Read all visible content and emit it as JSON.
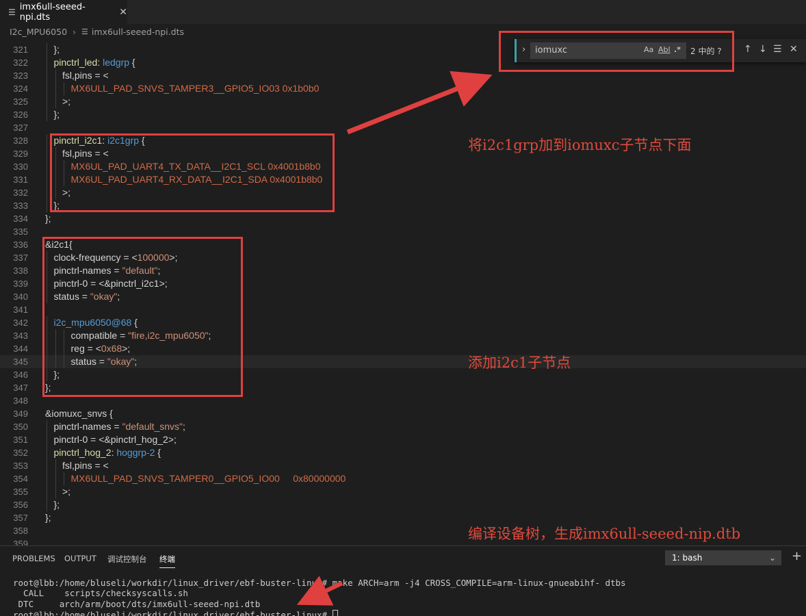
{
  "tab": {
    "title": "imx6ull-seeed-npi.dts",
    "close": "✕"
  },
  "breadcrumb": {
    "folder": "I2c_MPU6050",
    "file": "imx6ull-seeed-npi.dts"
  },
  "find": {
    "query": "iomuxc",
    "match_case": "Aa",
    "whole_word": "Abl",
    "regex": ".*",
    "count": "2 中的 ?"
  },
  "lines": [
    {
      "n": "321",
      "indent": 1,
      "parts": [
        [
          "plain",
          "};"
        ]
      ]
    },
    {
      "n": "322",
      "indent": 1,
      "parts": [
        [
          "label",
          "pinctrl_led"
        ],
        [
          "plain",
          ": "
        ],
        [
          "ref",
          "ledgrp"
        ],
        [
          "plain",
          " {"
        ]
      ]
    },
    {
      "n": "323",
      "indent": 2,
      "parts": [
        [
          "plain",
          "fsl,pins = <"
        ]
      ]
    },
    {
      "n": "324",
      "indent": 3,
      "parts": [
        [
          "mac",
          "MX6ULL_PAD_SNVS_TAMPER3__GPIO5_IO03 0x1b0b0"
        ]
      ]
    },
    {
      "n": "325",
      "indent": 2,
      "parts": [
        [
          "plain",
          ">;"
        ]
      ]
    },
    {
      "n": "326",
      "indent": 1,
      "parts": [
        [
          "plain",
          "};"
        ]
      ]
    },
    {
      "n": "327",
      "indent": 0,
      "parts": []
    },
    {
      "n": "328",
      "indent": 1,
      "parts": [
        [
          "label",
          "pinctrl_i2c1"
        ],
        [
          "plain",
          ": "
        ],
        [
          "ref",
          "i2c1grp"
        ],
        [
          "plain",
          " {"
        ]
      ]
    },
    {
      "n": "329",
      "indent": 2,
      "parts": [
        [
          "plain",
          "fsl,pins = <"
        ]
      ]
    },
    {
      "n": "330",
      "indent": 3,
      "parts": [
        [
          "mac",
          "MX6UL_PAD_UART4_TX_DATA__I2C1_SCL 0x4001b8b0"
        ]
      ]
    },
    {
      "n": "331",
      "indent": 3,
      "parts": [
        [
          "mac",
          "MX6UL_PAD_UART4_RX_DATA__I2C1_SDA 0x4001b8b0"
        ]
      ]
    },
    {
      "n": "332",
      "indent": 2,
      "parts": [
        [
          "plain",
          ">;"
        ]
      ]
    },
    {
      "n": "333",
      "indent": 1,
      "parts": [
        [
          "plain",
          "};"
        ]
      ]
    },
    {
      "n": "334",
      "indent": 0,
      "parts": [
        [
          "plain",
          "};"
        ]
      ]
    },
    {
      "n": "335",
      "indent": 0,
      "parts": []
    },
    {
      "n": "336",
      "indent": 0,
      "parts": [
        [
          "plain",
          "&i2c1{"
        ]
      ]
    },
    {
      "n": "337",
      "indent": 1,
      "parts": [
        [
          "plain",
          "clock-frequency = <"
        ],
        [
          "num",
          "100000"
        ],
        [
          "plain",
          ">;"
        ]
      ]
    },
    {
      "n": "338",
      "indent": 1,
      "parts": [
        [
          "plain",
          "pinctrl-names = "
        ],
        [
          "str",
          "\"default\""
        ],
        [
          "plain",
          ";"
        ]
      ]
    },
    {
      "n": "339",
      "indent": 1,
      "parts": [
        [
          "plain",
          "pinctrl-0 = <&pinctrl_i2c1>;"
        ]
      ]
    },
    {
      "n": "340",
      "indent": 1,
      "parts": [
        [
          "plain",
          "status = "
        ],
        [
          "str",
          "\"okay\""
        ],
        [
          "plain",
          ";"
        ]
      ]
    },
    {
      "n": "341",
      "indent": 0,
      "parts": []
    },
    {
      "n": "342",
      "indent": 1,
      "parts": [
        [
          "ref",
          "i2c_mpu6050@68"
        ],
        [
          "plain",
          " {"
        ]
      ]
    },
    {
      "n": "343",
      "indent": 3,
      "parts": [
        [
          "plain",
          "compatible = "
        ],
        [
          "str",
          "\"fire,i2c_mpu6050\""
        ],
        [
          "plain",
          ";"
        ]
      ]
    },
    {
      "n": "344",
      "indent": 3,
      "parts": [
        [
          "plain",
          "reg = <"
        ],
        [
          "num",
          "0x68"
        ],
        [
          "plain",
          ">;"
        ]
      ]
    },
    {
      "n": "345",
      "indent": 3,
      "parts": [
        [
          "plain",
          "status = "
        ],
        [
          "str",
          "\"okay\""
        ],
        [
          "plain",
          ";"
        ]
      ]
    },
    {
      "n": "346",
      "indent": 1,
      "parts": [
        [
          "plain",
          "};"
        ]
      ]
    },
    {
      "n": "347",
      "indent": 0,
      "parts": [
        [
          "plain",
          "};"
        ]
      ]
    },
    {
      "n": "348",
      "indent": 0,
      "parts": []
    },
    {
      "n": "349",
      "indent": 0,
      "parts": [
        [
          "plain",
          "&iomuxc_snvs {"
        ]
      ]
    },
    {
      "n": "350",
      "indent": 1,
      "parts": [
        [
          "plain",
          "pinctrl-names = "
        ],
        [
          "str",
          "\"default_snvs\""
        ],
        [
          "plain",
          ";"
        ]
      ]
    },
    {
      "n": "351",
      "indent": 1,
      "parts": [
        [
          "plain",
          "pinctrl-0 = <&pinctrl_hog_2>;"
        ]
      ]
    },
    {
      "n": "352",
      "indent": 1,
      "parts": [
        [
          "label",
          "pinctrl_hog_2"
        ],
        [
          "plain",
          ": "
        ],
        [
          "ref",
          "hoggrp-2"
        ],
        [
          "plain",
          " {"
        ]
      ]
    },
    {
      "n": "353",
      "indent": 2,
      "parts": [
        [
          "plain",
          "fsl,pins = <"
        ]
      ]
    },
    {
      "n": "354",
      "indent": 3,
      "parts": [
        [
          "mac",
          "MX6ULL_PAD_SNVS_TAMPER0__GPIO5_IO00     0x80000000"
        ]
      ]
    },
    {
      "n": "355",
      "indent": 2,
      "parts": [
        [
          "plain",
          ">;"
        ]
      ]
    },
    {
      "n": "356",
      "indent": 1,
      "parts": [
        [
          "plain",
          "};"
        ]
      ]
    },
    {
      "n": "357",
      "indent": 0,
      "parts": [
        [
          "plain",
          "};"
        ]
      ]
    },
    {
      "n": "358",
      "indent": 0,
      "parts": []
    },
    {
      "n": "359",
      "indent": 0,
      "parts": []
    }
  ],
  "annotations": {
    "a1": "将i2c1grp加到iomuxc子节点下面",
    "a2": "添加i2c1子节点",
    "a3": "编译设备树，生成imx6ull-seeed-nip.dtb"
  },
  "panel": {
    "tabs": [
      "PROBLEMS",
      "OUTPUT",
      "调试控制台",
      "终端"
    ],
    "terminal_select": "1: bash",
    "plus": "+"
  },
  "terminal": {
    "prompt": "root@lbb:/home/bluseli/workdir/linux_driver/ebf-buster-linux#",
    "command": "make ARCH=arm -j4 CROSS_COMPILE=arm-linux-gnueabihf- dtbs",
    "call_line": "  CALL    scripts/checksyscalls.sh",
    "dtc_line": " DTC     arch/arm/boot/dts/imx6ull-seeed-npi.dtb",
    "prompt2": "root@lbb:/home/bluseli/workdir/linux_driver/ebf-buster-linux# "
  },
  "colors": {
    "accent": "#e04040",
    "bg": "#1e1e1e"
  }
}
